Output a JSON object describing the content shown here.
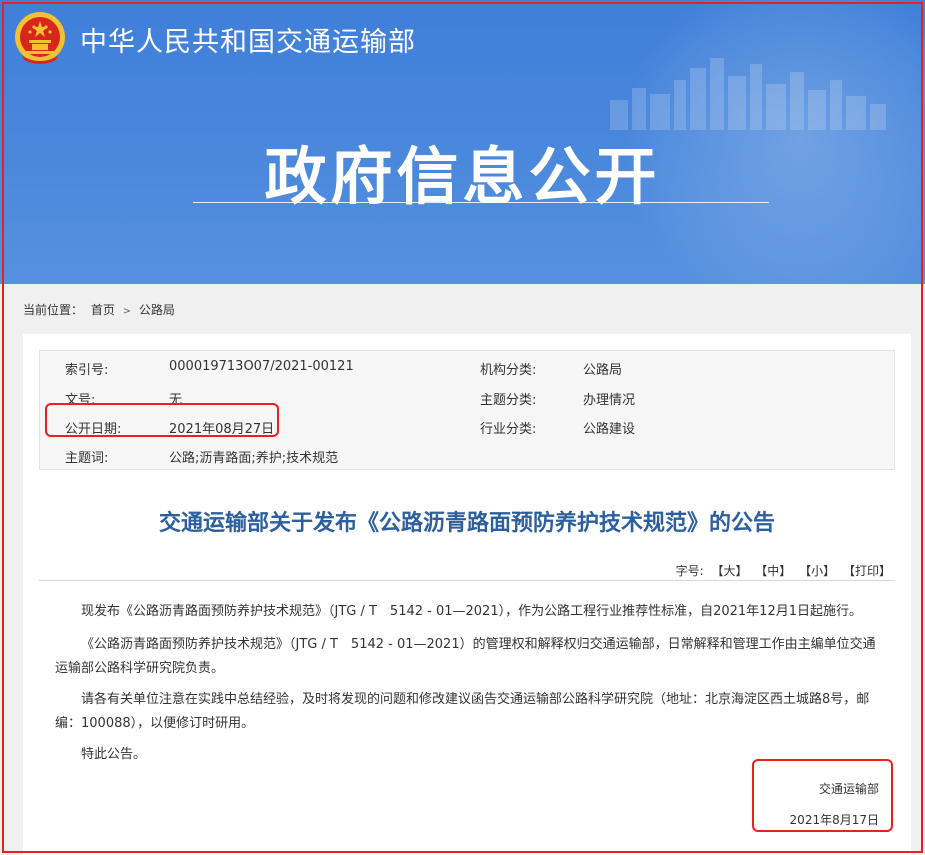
{
  "header": {
    "ministry_name": "中华人民共和国交通运输部",
    "banner_title": "政府信息公开",
    "emblem_icon": "national-emblem-icon"
  },
  "breadcrumb": {
    "label": "当前位置：",
    "items": [
      "首页",
      "公路局"
    ],
    "separator": ">"
  },
  "meta": {
    "index_no_label": "索引号:",
    "index_no": "000019713O07/2021-00121",
    "org_label": "机构分类:",
    "org": "公路局",
    "doc_no_label": "文号:",
    "doc_no": "无",
    "topic_label": "主题分类:",
    "topic": "办理情况",
    "pub_date_label": "公开日期:",
    "pub_date": "2021年08月27日",
    "industry_label": "行业分类:",
    "industry": "公路建设",
    "keywords_label": "主题词:",
    "keywords": "公路;沥青路面;养护;技术规范"
  },
  "article": {
    "title": "交通运输部关于发布《公路沥青路面预防养护技术规范》的公告",
    "font_size_label": "字号:",
    "font_large": "【大】",
    "font_medium": "【中】",
    "font_small": "【小】",
    "print": "【打印】",
    "paragraphs": [
      "现发布《公路沥青路面预防养护技术规范》（JTG / T　5142 - 01—2021），作为公路工程行业推荐性标准，自2021年12月1日起施行。",
      "《公路沥青路面预防养护技术规范》（JTG / T　5142 - 01—2021）的管理权和解释权归交通运输部，日常解释和管理工作由主编单位交通运输部公路科学研究院负责。",
      "请各有关单位注意在实践中总结经验，及时将发现的问题和修改建议函告交通运输部公路科学研究院（地址：北京海淀区西土城路8号，邮编：100088），以便修订时研用。",
      "特此公告。"
    ],
    "signature": "交通运输部",
    "sign_date": "2021年8月17日"
  },
  "colors": {
    "banner": "#4a88dc",
    "title": "#2c5f9e",
    "highlight": "#e8201e"
  }
}
